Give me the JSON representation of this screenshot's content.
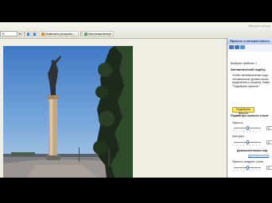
{
  "toolbar": {
    "field_value": "%",
    "edit_picture_label": "Изменить рисунки...",
    "autocorrect_label": "Автоизменение",
    "search_hint": "Введите вопро"
  },
  "task_pane": {
    "title": "Яркость и контрастность",
    "selected_files": "Выбрано файлов: 1",
    "auto_section_title": "Автоматический подбор",
    "auto_desc": [
      "Чтобы автоматически подо",
      "оптимальные уровни яркос",
      "выделенного рисунка, нажм",
      "\"Подобрать яркость\"."
    ],
    "auto_button_label": "Подобрать яркость",
    "params_title": "Параметры яркости и конт",
    "brightness_label": "Яркость",
    "brightness_value": "0",
    "contrast_label": "Контраст",
    "contrast_value": "0",
    "extra_title": "Дополнительные пар",
    "extra_link": "Дополнительны",
    "midtone_label": "Яркость средних тонов",
    "midtone_value": "0"
  },
  "sliders": {
    "brightness_pos": 0.5,
    "contrast_pos": 0.5,
    "midtone_pos": 0.5
  },
  "colors": {
    "accent": "#ffe86a",
    "pane_header": "#b6cbf0",
    "link": "#2d56b3"
  }
}
